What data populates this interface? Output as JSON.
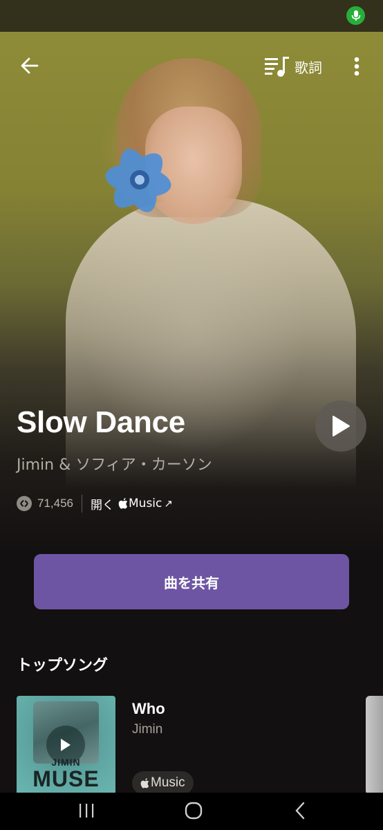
{
  "header": {
    "lyrics_label": "歌詞"
  },
  "song": {
    "title": "Slow Dance",
    "artist": "Jimin & ソフィア・カーソン",
    "shazam_count": "71,456",
    "open_label": "開く",
    "service_label": "Music",
    "arrow": "↗"
  },
  "share": {
    "label": "曲を共有"
  },
  "top_songs": {
    "heading": "トップソング",
    "items": [
      {
        "title": "Who",
        "artist": "Jimin",
        "cover_text_small": "JIMIN",
        "cover_text_large": "MUSE",
        "badge": "Music"
      }
    ]
  },
  "icons": {
    "back": "arrow-left-icon",
    "lyrics": "lyrics-icon",
    "more": "more-vertical-icon",
    "play": "play-icon",
    "shazam": "shazam-icon",
    "apple": "apple-logo-icon",
    "mic": "microphone-icon"
  },
  "colors": {
    "accent": "#6d55a3",
    "mic_indicator": "#27ae3a",
    "background": "#121010"
  }
}
